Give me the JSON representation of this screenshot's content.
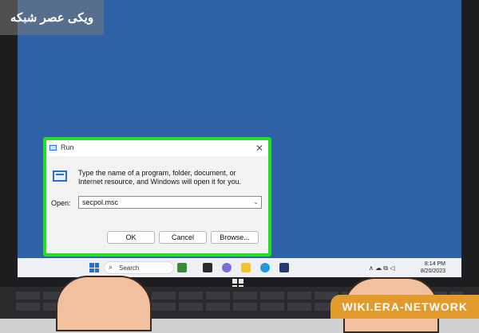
{
  "watermarks": {
    "top": "ویکی عصر شبکه",
    "bottom": "WIKI.ERA-NETWORK"
  },
  "run_dialog": {
    "title": "Run",
    "description": "Type the name of a program, folder, document, or Internet resource, and Windows will open it for you.",
    "open_label": "Open:",
    "open_value": "secpol.msc",
    "ok_label": "OK",
    "cancel_label": "Cancel",
    "browse_label": "Browse...",
    "close_glyph": "✕",
    "dropdown_glyph": "⌄"
  },
  "taskbar": {
    "search_placeholder": "Search",
    "search_glyph": "⌕",
    "time": "8:14 PM",
    "date": "8/20/2023",
    "tray_glyphs": "∧ ☁ ⧉ ◁"
  },
  "colors": {
    "desktop": "#2f62a6",
    "highlight": "#22e022",
    "watermark_bottom": "#e39a2d"
  }
}
